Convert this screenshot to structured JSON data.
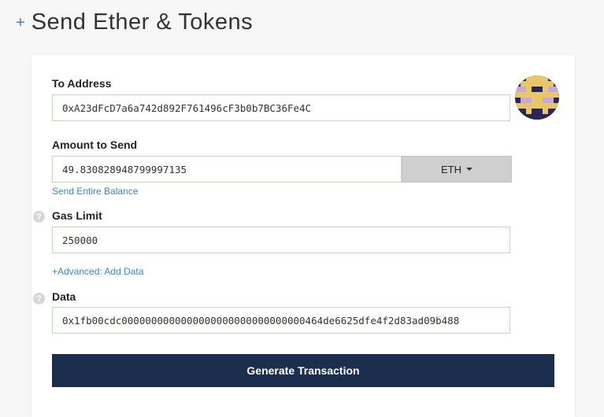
{
  "header": {
    "plus_glyph": "+",
    "title": "Send Ether & Tokens"
  },
  "form": {
    "to_address": {
      "label": "To Address",
      "value": "0xA23dFcD7a6a742d892F761496cF3b0b7BC36Fe4C",
      "identicon": "address-identicon"
    },
    "amount": {
      "label": "Amount to Send",
      "value": "49.830828948799997135",
      "unit": "ETH",
      "send_entire_balance": "Send Entire Balance"
    },
    "gas_limit": {
      "label": "Gas Limit",
      "value": "250000",
      "help_glyph": "?"
    },
    "advanced_link": "+Advanced: Add Data",
    "data": {
      "label": "Data",
      "value": "0x1fb00cdc0000000000000000000000000000000464de6625dfe4f2d83ad09b488",
      "help_glyph": "?"
    },
    "generate_button": "Generate Transaction"
  },
  "colors": {
    "accent": "#3b87c5",
    "button_bg": "#1c2e4d",
    "input_border": "#b9e0b0",
    "dropdown_bg": "#cfcfcf"
  }
}
